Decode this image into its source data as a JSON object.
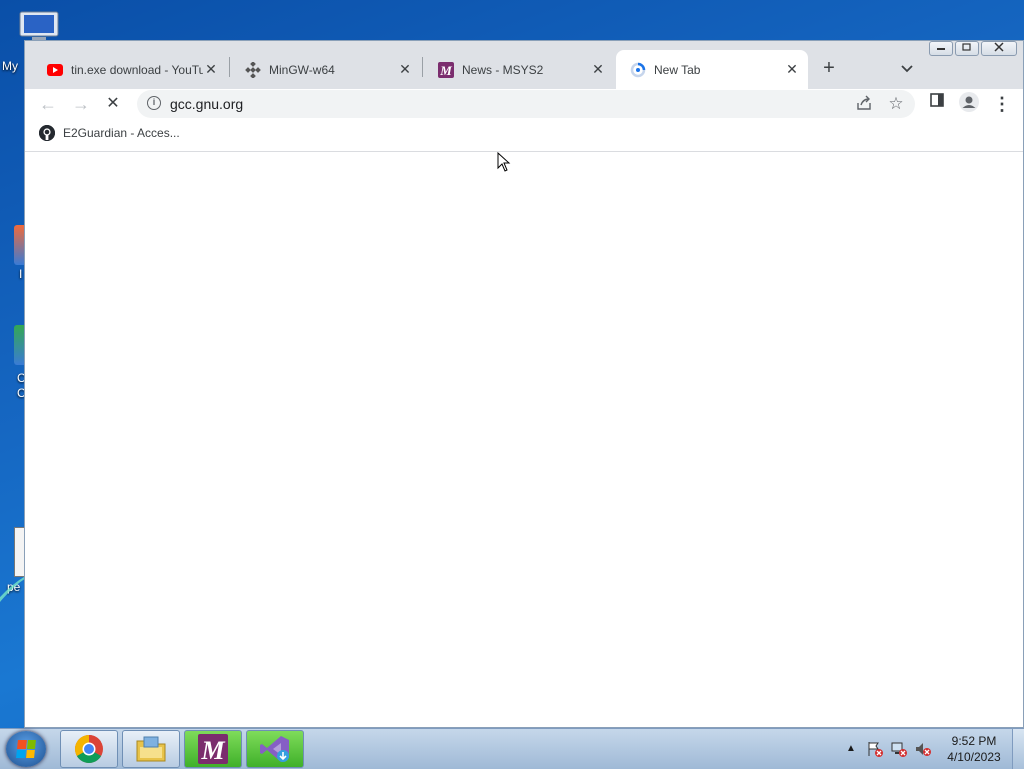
{
  "desktop": {
    "icon_labels": [
      "My",
      "I",
      "C",
      "C",
      "pe"
    ]
  },
  "tabs": [
    {
      "title": "tin.exe download - YouTube",
      "favicon": "youtube-icon",
      "active": false
    },
    {
      "title": "MinGW-w64",
      "favicon": "mingw-icon",
      "active": false
    },
    {
      "title": "News - MSYS2",
      "favicon": "msys2-icon",
      "active": false
    },
    {
      "title": "New Tab",
      "favicon": "loading-icon",
      "active": true
    }
  ],
  "toolbar": {
    "url": "gcc.gnu.org",
    "back_icon": "←",
    "forward_icon": "→",
    "stop_icon": "✕",
    "new_tab_icon": "+",
    "tab_search_icon": "⌄",
    "close_tab_glyph": "✕",
    "star_icon": "☆",
    "menu_icon": "⋮"
  },
  "bookmarks": [
    {
      "label": "E2Guardian - Acces...",
      "icon": "github-icon"
    }
  ],
  "taskbar": {
    "apps": [
      "chrome-icon",
      "file-explorer-icon",
      "msys2-icon",
      "visual-studio-installer-icon"
    ],
    "clock_time": "9:52 PM",
    "clock_date": "4/10/2023"
  },
  "colors": {
    "tabstrip_bg": "#dee1e6",
    "youtube_red": "#ff0000",
    "msys2_purple": "#7b2d6e",
    "chrome_blue": "#1a73e8"
  }
}
